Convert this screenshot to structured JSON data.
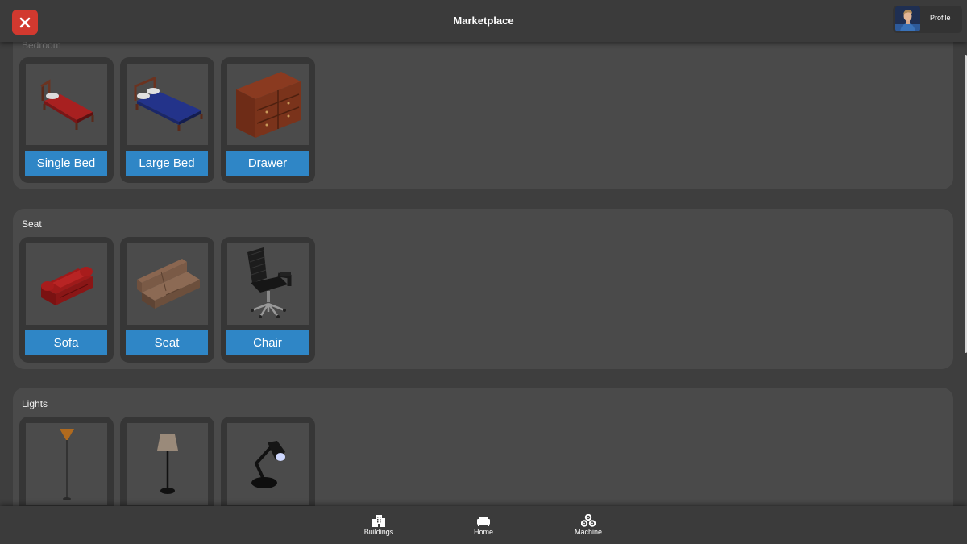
{
  "header": {
    "title": "Marketplace",
    "profile_label": "Profile",
    "close_color": "#d2392f"
  },
  "categories": [
    {
      "title": "Bedroom",
      "items": [
        {
          "label": "Single Bed",
          "icon": "single-bed-image"
        },
        {
          "label": "Large Bed",
          "icon": "large-bed-image"
        },
        {
          "label": "Drawer",
          "icon": "drawer-image"
        }
      ]
    },
    {
      "title": "Seat",
      "items": [
        {
          "label": "Sofa",
          "icon": "sofa-image"
        },
        {
          "label": "Seat",
          "icon": "seat-image"
        },
        {
          "label": "Chair",
          "icon": "chair-image"
        }
      ]
    },
    {
      "title": "Lights",
      "items": [
        {
          "label": "",
          "icon": "torchiere-lamp-image"
        },
        {
          "label": "",
          "icon": "floor-lamp-image"
        },
        {
          "label": "",
          "icon": "desk-lamp-image"
        }
      ]
    }
  ],
  "bottom_nav": [
    {
      "label": "Buildings",
      "icon": "buildings-icon"
    },
    {
      "label": "Home",
      "icon": "home-sofa-icon"
    },
    {
      "label": "Machine",
      "icon": "machine-gears-icon"
    }
  ],
  "colors": {
    "accent": "#2f86c6",
    "background": "#3e3e3e",
    "panel": "#4a4a4a",
    "card": "#363636"
  }
}
